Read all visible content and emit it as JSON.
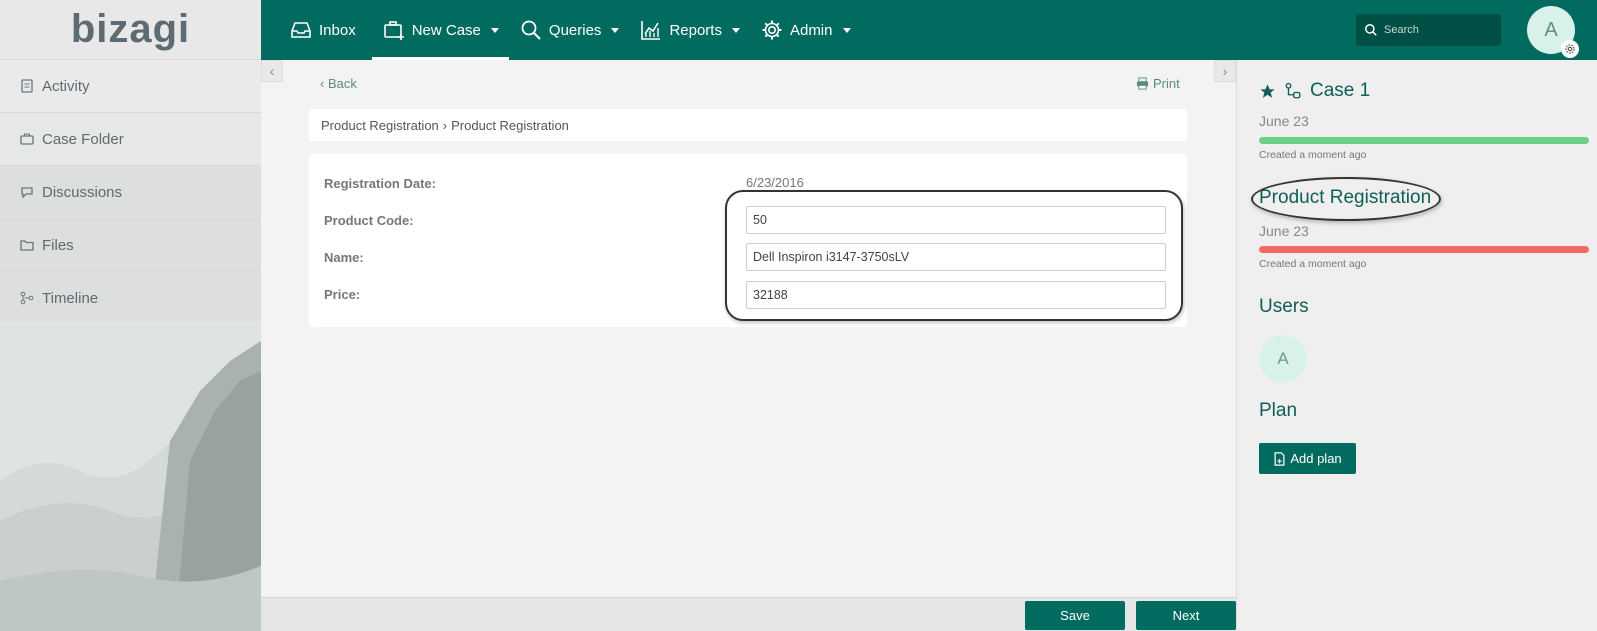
{
  "logo": "bizagi",
  "sidebar": {
    "items": [
      {
        "label": "Activity",
        "icon": "clipboard-icon"
      },
      {
        "label": "Case Folder",
        "icon": "case-folder-icon"
      },
      {
        "label": "Discussions",
        "icon": "chat-bubble-icon"
      },
      {
        "label": "Files",
        "icon": "folder-icon"
      },
      {
        "label": "Timeline",
        "icon": "timeline-icon"
      }
    ]
  },
  "topnav": {
    "inbox": "Inbox",
    "new_case": "New Case",
    "queries": "Queries",
    "reports": "Reports",
    "admin": "Admin",
    "search_placeholder": "Search",
    "avatar_initial": "A"
  },
  "content": {
    "back": "Back",
    "print": "Print",
    "breadcrumb": [
      "Product Registration",
      "›",
      "Product Registration"
    ]
  },
  "form": {
    "registration_date_label": "Registration Date:",
    "registration_date_value": "6/23/2016",
    "product_code_label": "Product Code:",
    "product_code_value": "50",
    "name_label": "Name:",
    "name_value": "Dell Inspiron i3147-3750sLV",
    "price_label": "Price:",
    "price_value": "32188"
  },
  "right_panel": {
    "case_title": "Case 1",
    "case_date": "June 23",
    "case_created": "Created a moment ago",
    "task_title": "Product Registration",
    "task_date": "June 23",
    "task_created": "Created a moment ago",
    "users_title": "Users",
    "user_initial": "A",
    "plan_title": "Plan",
    "add_plan": "Add plan"
  },
  "footer": {
    "save": "Save",
    "next": "Next"
  },
  "colors": {
    "brand": "#006b5e",
    "case_progress": "#6ccf8a",
    "task_progress": "#ee6b66"
  }
}
